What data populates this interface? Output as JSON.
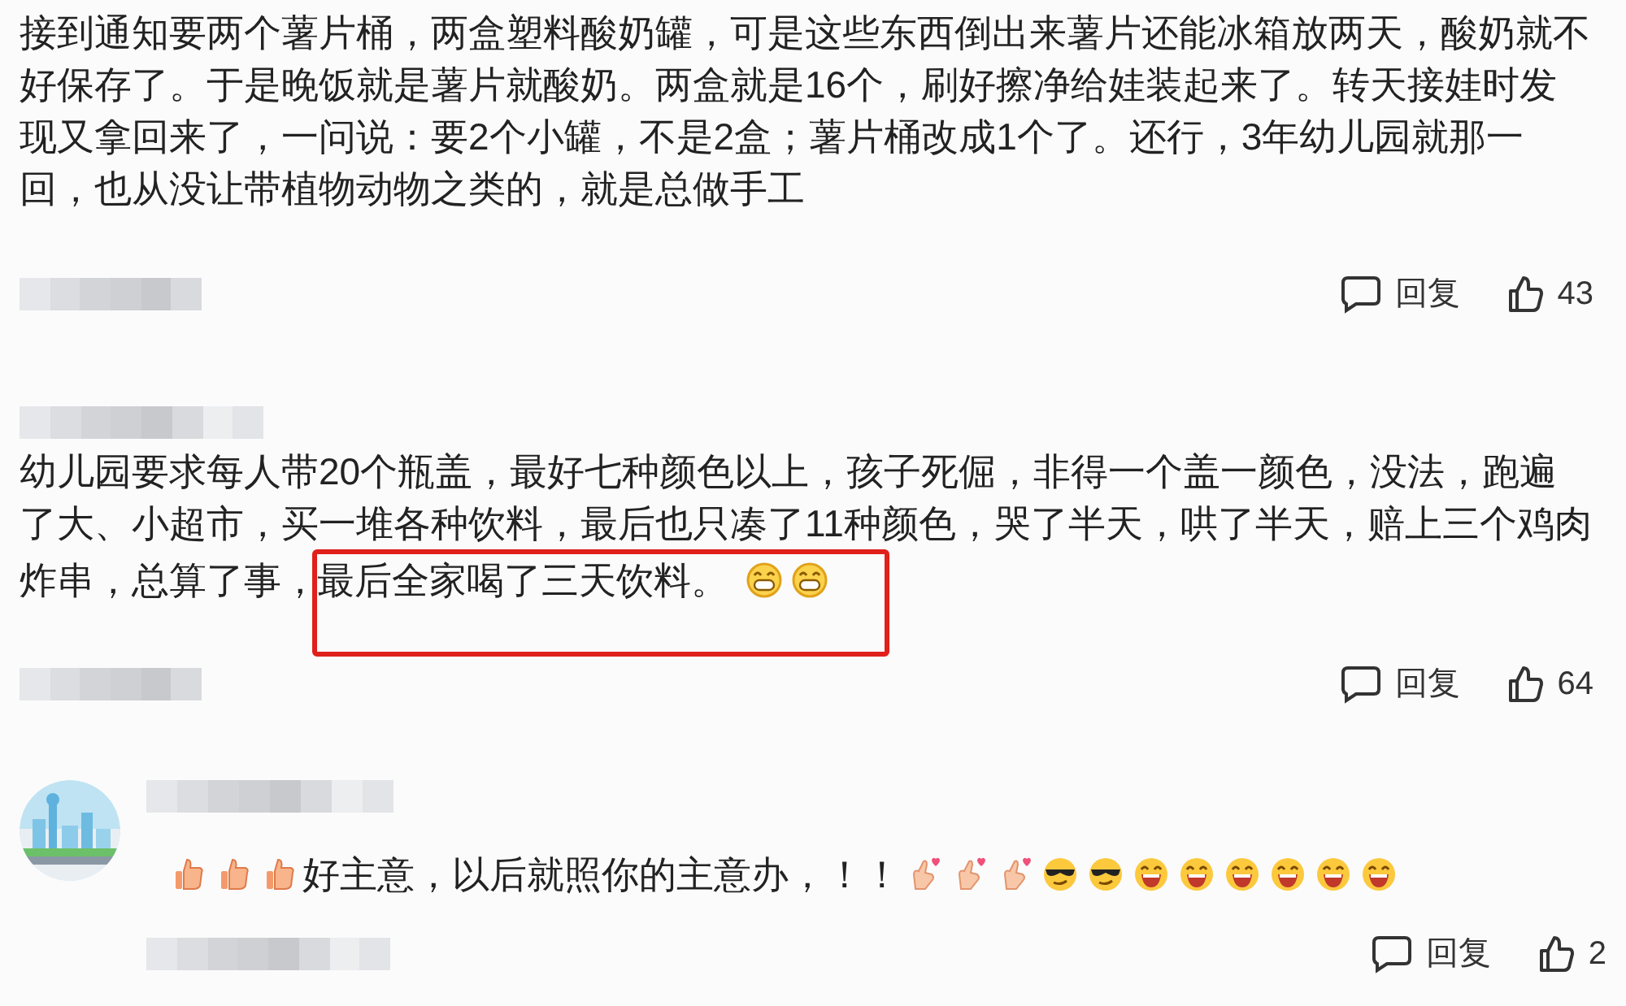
{
  "comments": [
    {
      "content": [
        {
          "kind": "text",
          "text": "接到通知要两个薯片桶，两盒塑料酸奶罐，可是这些东西倒出来薯片还能冰箱放两天，酸奶就不好保存了。于是晚饭就是薯片就酸奶。两盒就是16个，刷好擦净给娃装起来了。转天接娃时发现又拿回来了，一问说：要2个小罐，不是2盒；薯片桶改成1个了。还行，3年幼儿园就那一回，也从没让带植物动物之类的，就是总做手工"
        }
      ],
      "reply_label": "回复",
      "likes": "43"
    },
    {
      "content": [
        {
          "kind": "text",
          "text": "幼儿园要求每人带20个瓶盖，最好七种颜色以上，孩子死倔，非得一个盖一颜色，没法，跑遍了大、小超市，买一堆各种饮料，最后也只凑了11种颜色，哭了半天，哄了半天，赔上三个鸡肉炸串，总算了事，"
        },
        {
          "kind": "highlight",
          "text": "最后全家喝了三天饮料。",
          "emojis": [
            {
              "kind": "grin"
            },
            {
              "kind": "grin"
            }
          ]
        }
      ],
      "reply_label": "回复",
      "likes": "64"
    },
    {
      "content": [
        {
          "kind": "thumb"
        },
        {
          "kind": "thumb"
        },
        {
          "kind": "thumb"
        },
        {
          "kind": "text",
          "text": "好主意，以后就照你的主意办，！！"
        },
        {
          "kind": "finger-heart"
        },
        {
          "kind": "finger-heart"
        },
        {
          "kind": "finger-heart"
        },
        {
          "kind": "sunglasses"
        },
        {
          "kind": "sunglasses"
        },
        {
          "kind": "laugh"
        },
        {
          "kind": "laugh"
        },
        {
          "kind": "laugh"
        },
        {
          "kind": "laugh"
        },
        {
          "kind": "laugh"
        },
        {
          "kind": "laugh"
        }
      ],
      "reply_label": "回复",
      "likes": "2"
    }
  ]
}
